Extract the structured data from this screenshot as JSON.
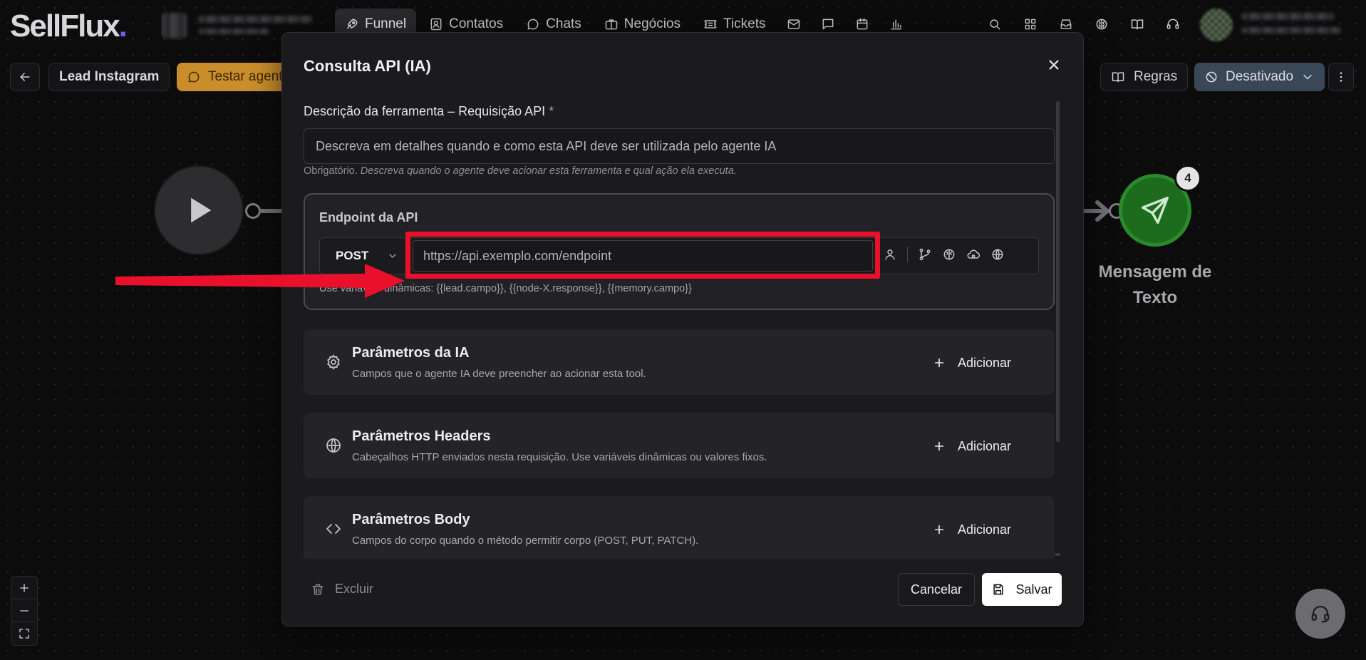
{
  "app": {
    "logo_text": "SellFlux",
    "logo_dot": "."
  },
  "nav": {
    "items": [
      {
        "label": "Funnel",
        "icon": "funnel-rocket-icon",
        "active": true
      },
      {
        "label": "Contatos",
        "icon": "contacts-icon"
      },
      {
        "label": "Chats",
        "icon": "chat-bubble-icon"
      },
      {
        "label": "Negócios",
        "icon": "briefcase-icon"
      },
      {
        "label": "Tickets",
        "icon": "ticket-icon"
      }
    ],
    "quick_icons": [
      "mail-icon",
      "message-square-icon",
      "calendar-icon",
      "bar-chart-icon"
    ],
    "right_icons": [
      "search-icon",
      "grid-icon",
      "inbox-icon",
      "brain-icon",
      "book-icon",
      "headset-icon"
    ]
  },
  "toolbar": {
    "flow_name": "Lead Instagram",
    "test_agent_label": "Testar agente",
    "rules_label": "Regras",
    "status_label": "Desativado"
  },
  "canvas": {
    "message_node_label": "Mensagem de Texto",
    "message_node_badge": "4"
  },
  "modal": {
    "title": "Consulta API (IA)",
    "description": {
      "label": "Descrição da ferramenta – Requisição API",
      "required_mark": "*",
      "placeholder": "Descreva em detalhes quando e como esta API deve ser utilizada pelo agente IA",
      "hint_prefix": "Obrigatório.",
      "hint_text": "Descreva quando o agente deve acionar esta ferramenta e qual ação ela executa."
    },
    "endpoint": {
      "title": "Endpoint da API",
      "method": "POST",
      "url_placeholder": "https://api.exemplo.com/endpoint",
      "dynamic_hint": "Use variáveis dinâmicas: {{lead.campo}}, {{node-X.response}}, {{memory.campo}}"
    },
    "params": [
      {
        "title": "Parâmetros da IA",
        "subtitle": "Campos que o agente IA deve preencher ao acionar esta tool.",
        "icon": "gear-icon",
        "add_label": "Adicionar"
      },
      {
        "title": "Parâmetros Headers",
        "subtitle": "Cabeçalhos HTTP enviados nesta requisição. Use variáveis dinâmicas ou valores fixos.",
        "icon": "globe-icon",
        "add_label": "Adicionar"
      },
      {
        "title": "Parâmetros Body",
        "subtitle": "Campos do corpo quando o método permitir corpo (POST, PUT, PATCH).",
        "icon": "code-icon",
        "add_label": "Adicionar"
      }
    ],
    "footer": {
      "delete_label": "Excluir",
      "cancel_label": "Cancelar",
      "save_label": "Salvar"
    }
  },
  "colors": {
    "highlight": "#e8102b",
    "test_button": "#c98d2b",
    "status_button": "#3a4757",
    "message_node": "#1d6b1d"
  }
}
